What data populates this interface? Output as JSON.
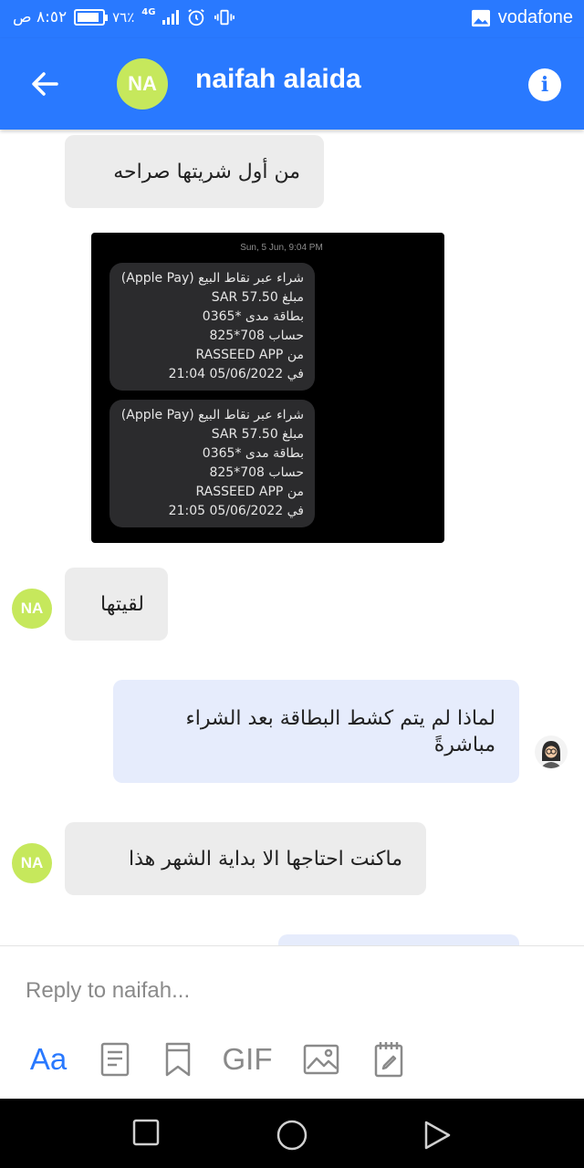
{
  "status_bar": {
    "time": "٨:٥٢ ص",
    "battery": "٧٦٪",
    "battery_level": 0.76,
    "network": "4G",
    "carrier": "vodafone"
  },
  "header": {
    "avatar_initials": "NA",
    "contact_name": "naifah alaida"
  },
  "messages": {
    "m1": "من أول شريتها صراحه",
    "m2": "لقيتها",
    "m3_line1": "لماذا لم يتم كشط البطاقة بعد الشراء",
    "m3_line2": "مباشرةً",
    "m4": "ماكنت احتاجها الا بداية الشهر هذا",
    "avatar_initials": "NA"
  },
  "sms_screenshot": {
    "date": "Sun, 5 Jun, 9:04 PM",
    "sms1": {
      "line1": "شراء عبر نقاط البيع (Apple Pay)",
      "line2": "مبلغ SAR 57.50",
      "line3": "بطاقة مدى *0365",
      "line4": "حساب 708*825",
      "line5": "من RASSEED APP",
      "line6": "في 05/06/2022 21:04"
    },
    "sms2": {
      "line1": "شراء عبر نقاط البيع (Apple Pay)",
      "line2": "مبلغ SAR 57.50",
      "line3": "بطاقة مدى *0365",
      "line4": "حساب 708*825",
      "line5": "من RASSEED APP",
      "line6": "في 05/06/2022 21:05"
    }
  },
  "composer": {
    "placeholder": "Reply to naifah...",
    "aa_label": "Aa",
    "gif_label": "GIF"
  },
  "colors": {
    "accent": "#2979ff",
    "avatar": "#c6e85c",
    "incoming_bubble": "#ececec",
    "outgoing_bubble": "#e6ecfc"
  }
}
